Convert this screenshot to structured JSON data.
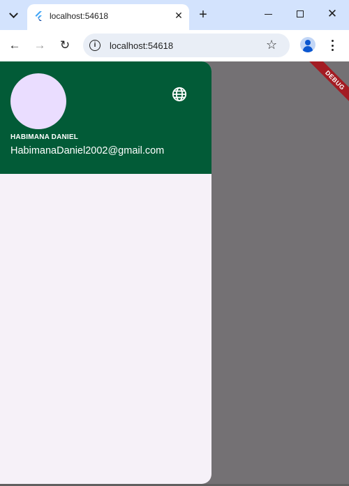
{
  "browser": {
    "tab_title": "localhost:54618",
    "url": "localhost:54618",
    "close_glyph": "✕",
    "newtab_glyph": "+",
    "star_glyph": "☆",
    "back_glyph": "←",
    "forward_glyph": "→",
    "reload_glyph": "↻",
    "info_glyph": "i"
  },
  "drawer": {
    "account_name": "HABIMANA DANIEL",
    "account_email": "HabimanaDaniel2002@gmail.com",
    "header_color": "#025b37",
    "avatar_color": "#eaddff",
    "icons": [
      "language-icon"
    ]
  },
  "debug_banner": {
    "label": "DEBUG",
    "color": "#a31c23"
  }
}
